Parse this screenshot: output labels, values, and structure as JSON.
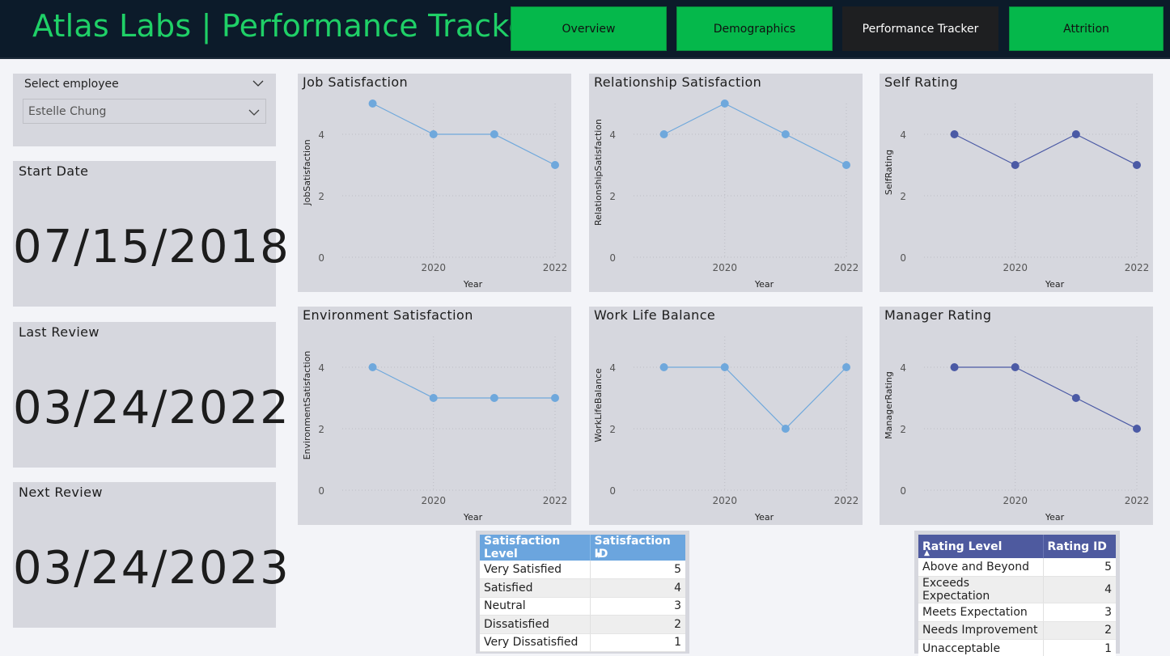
{
  "header": {
    "title": "Atlas Labs | Performance Tracker",
    "nav": [
      {
        "label": "Overview",
        "active": false
      },
      {
        "label": "Demographics",
        "active": false
      },
      {
        "label": "Performance Tracker",
        "active": true
      },
      {
        "label": "Attrition",
        "active": false
      }
    ]
  },
  "slicer": {
    "title": "Select employee",
    "selected": "Estelle Chung"
  },
  "cards": {
    "start_date": {
      "label": "Start Date",
      "value": "07/15/2018"
    },
    "last_review": {
      "label": "Last Review",
      "value": "03/24/2022"
    },
    "next_review": {
      "label": "Next Review",
      "value": "03/24/2023"
    }
  },
  "colors": {
    "header_bg": "#0c1b2a",
    "title_green": "#1fd067",
    "nav_green": "#05b84b",
    "nav_active": "#1e1f21",
    "card_bg": "#d6d7de",
    "light_series": "#6fa8dc",
    "dark_series": "#4b5aa5",
    "sat_table_header": "#6ba5de",
    "rating_table_header": "#4e5a9f"
  },
  "chart_data": [
    {
      "id": "job",
      "type": "line",
      "title": "Job Satisfaction",
      "xlabel": "Year",
      "ylabel": "JobSatisfaction",
      "x": [
        2019,
        2020,
        2021,
        2022
      ],
      "values": [
        5,
        4,
        4,
        3
      ],
      "x_ticks": [
        "2020",
        "2022"
      ],
      "y_ticks": [
        "0",
        "2",
        "4"
      ],
      "ylim": [
        0,
        5
      ],
      "color": "#6fa8dc"
    },
    {
      "id": "relationship",
      "type": "line",
      "title": "Relationship Satisfaction",
      "xlabel": "Year",
      "ylabel": "RelationshipSatisfaction",
      "x": [
        2019,
        2020,
        2021,
        2022
      ],
      "values": [
        4,
        5,
        4,
        3
      ],
      "x_ticks": [
        "2020",
        "2022"
      ],
      "y_ticks": [
        "0",
        "2",
        "4"
      ],
      "ylim": [
        0,
        5
      ],
      "color": "#6fa8dc"
    },
    {
      "id": "self",
      "type": "line",
      "title": "Self Rating",
      "xlabel": "Year",
      "ylabel": "SelfRating",
      "x": [
        2019,
        2020,
        2021,
        2022
      ],
      "values": [
        4,
        3,
        4,
        3
      ],
      "x_ticks": [
        "2020",
        "2022"
      ],
      "y_ticks": [
        "0",
        "2",
        "4"
      ],
      "ylim": [
        0,
        5
      ],
      "color": "#4b5aa5"
    },
    {
      "id": "environment",
      "type": "line",
      "title": "Environment Satisfaction",
      "xlabel": "Year",
      "ylabel": "EnvironmentSatisfaction",
      "x": [
        2019,
        2020,
        2021,
        2022
      ],
      "values": [
        4,
        3,
        3,
        3
      ],
      "x_ticks": [
        "2020",
        "2022"
      ],
      "y_ticks": [
        "0",
        "2",
        "4"
      ],
      "ylim": [
        0,
        5
      ],
      "color": "#6fa8dc"
    },
    {
      "id": "worklife",
      "type": "line",
      "title": "Work Life Balance",
      "xlabel": "Year",
      "ylabel": "WorkLifeBalance",
      "x": [
        2019,
        2020,
        2021,
        2022
      ],
      "values": [
        4,
        4,
        2,
        4
      ],
      "x_ticks": [
        "2020",
        "2022"
      ],
      "y_ticks": [
        "0",
        "2",
        "4"
      ],
      "ylim": [
        0,
        5
      ],
      "color": "#6fa8dc"
    },
    {
      "id": "manager",
      "type": "line",
      "title": "Manager Rating",
      "xlabel": "Year",
      "ylabel": "ManagerRating",
      "x": [
        2019,
        2020,
        2021,
        2022
      ],
      "values": [
        4,
        4,
        3,
        2
      ],
      "x_ticks": [
        "2020",
        "2022"
      ],
      "y_ticks": [
        "0",
        "2",
        "4"
      ],
      "ylim": [
        0,
        5
      ],
      "color": "#4b5aa5"
    }
  ],
  "satisfaction_table": {
    "headers": [
      "Satisfaction Level",
      "Satisfaction ID"
    ],
    "rows": [
      [
        "Very Satisfied",
        "5"
      ],
      [
        "Satisfied",
        "4"
      ],
      [
        "Neutral",
        "3"
      ],
      [
        "Dissatisfied",
        "2"
      ],
      [
        "Very Dissatisfied",
        "1"
      ]
    ]
  },
  "rating_table": {
    "headers": [
      "Rating Level",
      "Rating ID"
    ],
    "rows": [
      [
        "Above and Beyond",
        "5"
      ],
      [
        "Exceeds Expectation",
        "4"
      ],
      [
        "Meets Expectation",
        "3"
      ],
      [
        "Needs Improvement",
        "2"
      ],
      [
        "Unacceptable",
        "1"
      ]
    ]
  }
}
